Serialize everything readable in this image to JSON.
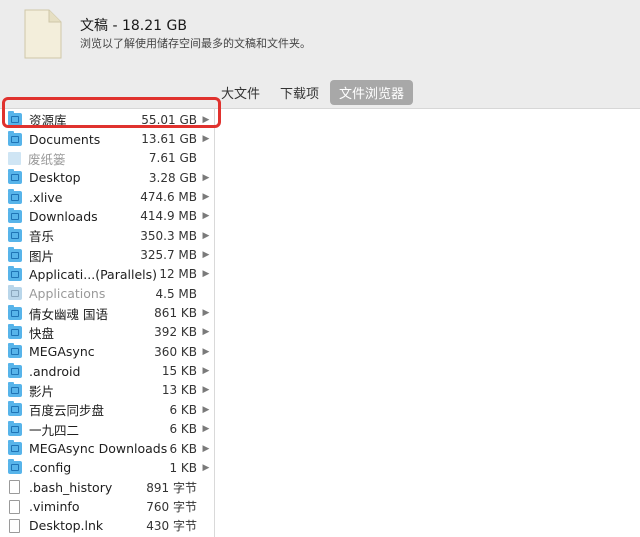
{
  "header": {
    "title": "文稿 - 18.21 GB",
    "subtitle": "浏览以了解使用储存空间最多的文稿和文件夹。",
    "doc_icon": "document-icon"
  },
  "tabs": [
    {
      "label": "大文件",
      "active": false
    },
    {
      "label": "下载项",
      "active": false
    },
    {
      "label": "文件浏览器",
      "active": true
    }
  ],
  "items": [
    {
      "name": "资源库",
      "size": "55.01 GB",
      "icon": "folder-icon",
      "arrow": true,
      "dim": false,
      "highlighted": true
    },
    {
      "name": "Documents",
      "size": "13.61 GB",
      "icon": "folder-icon",
      "arrow": true,
      "dim": false
    },
    {
      "name": "废纸篓",
      "size": "7.61 GB",
      "icon": "trash-icon",
      "arrow": false,
      "dim": true
    },
    {
      "name": "Desktop",
      "size": "3.28 GB",
      "icon": "folder-icon",
      "arrow": true,
      "dim": false
    },
    {
      "name": ".xlive",
      "size": "474.6 MB",
      "icon": "folder-icon",
      "arrow": true,
      "dim": false
    },
    {
      "name": "Downloads",
      "size": "414.9 MB",
      "icon": "folder-icon",
      "arrow": true,
      "dim": false
    },
    {
      "name": "音乐",
      "size": "350.3 MB",
      "icon": "folder-icon",
      "arrow": true,
      "dim": false
    },
    {
      "name": "图片",
      "size": "325.7 MB",
      "icon": "folder-icon",
      "arrow": true,
      "dim": false
    },
    {
      "name": "Applicati...(Parallels)",
      "size": "12 MB",
      "icon": "folder-icon",
      "arrow": true,
      "dim": false
    },
    {
      "name": "Applications",
      "size": "4.5 MB",
      "icon": "folder-icon",
      "arrow": false,
      "dim": true
    },
    {
      "name": "倩女幽魂 国语",
      "size": "861 KB",
      "icon": "folder-icon",
      "arrow": true,
      "dim": false
    },
    {
      "name": "快盘",
      "size": "392 KB",
      "icon": "folder-icon",
      "arrow": true,
      "dim": false
    },
    {
      "name": "MEGAsync",
      "size": "360 KB",
      "icon": "folder-icon",
      "arrow": true,
      "dim": false
    },
    {
      "name": ".android",
      "size": "15 KB",
      "icon": "folder-icon",
      "arrow": true,
      "dim": false
    },
    {
      "name": "影片",
      "size": "13 KB",
      "icon": "folder-icon",
      "arrow": true,
      "dim": false
    },
    {
      "name": "百度云同步盘",
      "size": "6 KB",
      "icon": "folder-icon",
      "arrow": true,
      "dim": false
    },
    {
      "name": "一九四二",
      "size": "6 KB",
      "icon": "folder-icon",
      "arrow": true,
      "dim": false
    },
    {
      "name": "MEGAsync Downloads",
      "size": "6 KB",
      "icon": "folder-icon",
      "arrow": true,
      "dim": false
    },
    {
      "name": ".config",
      "size": "1 KB",
      "icon": "folder-icon",
      "arrow": true,
      "dim": false
    },
    {
      "name": ".bash_history",
      "size": "891 字节",
      "icon": "file-icon",
      "arrow": false,
      "dim": false
    },
    {
      "name": ".viminfo",
      "size": "760 字节",
      "icon": "file-icon",
      "arrow": false,
      "dim": false
    },
    {
      "name": "Desktop.lnk",
      "size": "430 字节",
      "icon": "file-icon",
      "arrow": false,
      "dim": false
    }
  ],
  "arrow_glyph": "▶",
  "colors": {
    "highlight": "#e0322e",
    "folder": "#57b4ea",
    "tab_active": "#a8a8a8"
  }
}
